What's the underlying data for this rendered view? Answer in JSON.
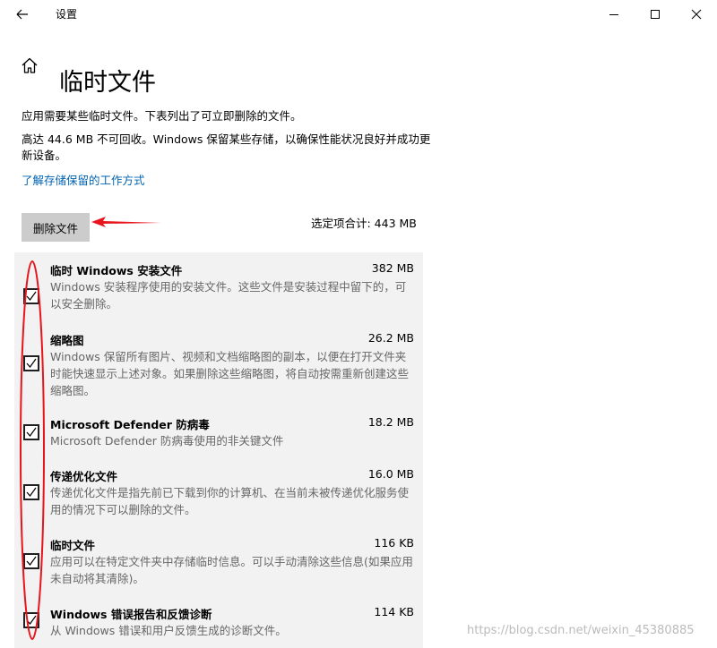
{
  "window": {
    "title": "设置",
    "back_icon": "back-arrow-icon",
    "minimize_icon": "minimize-icon",
    "maximize_icon": "maximize-icon",
    "close_icon": "close-icon"
  },
  "page": {
    "home_icon": "home-icon",
    "title": "临时文件",
    "description_1": "应用需要某些临时文件。下表列出了可立即删除的文件。",
    "description_2": "高达 44.6 MB 不可回收。Windows 保留某些存储，以确保性能状况良好并成功更新设备。",
    "learn_more_link": "了解存储保留的工作方式",
    "delete_button": "删除文件",
    "selected_total": "选定项合计: 443 MB"
  },
  "files": [
    {
      "name": "临时 Windows 安装文件",
      "size": "382 MB",
      "checked": true,
      "description": "Windows 安装程序使用的安装文件。这些文件是安装过程中留下的，可以安全删除。"
    },
    {
      "name": "缩略图",
      "size": "26.2 MB",
      "checked": true,
      "description": "Windows 保留所有图片、视频和文档缩略图的副本，以便在打开文件夹时能快速显示上述对象。如果删除这些缩略图，将自动按需重新创建这些缩略图。"
    },
    {
      "name": "Microsoft Defender 防病毒",
      "size": "18.2 MB",
      "checked": true,
      "description": "Microsoft Defender 防病毒使用的非关键文件"
    },
    {
      "name": "传递优化文件",
      "size": "16.0 MB",
      "checked": true,
      "description": "传递优化文件是指先前已下载到你的计算机、在当前未被传递优化服务使用的情况下可以删除的文件。"
    },
    {
      "name": "临时文件",
      "size": "116 KB",
      "checked": true,
      "description": "应用可以在特定文件夹中存储临时信息。可以手动清除这些信息(如果应用未自动将其清除)。"
    },
    {
      "name": "Windows 错误报告和反馈诊断",
      "size": "114 KB",
      "checked": true,
      "description": "从 Windows 错误和用户反馈生成的诊断文件。"
    }
  ],
  "annotation": {
    "color": "#e8141c"
  },
  "watermark": "https://blog.csdn.net/weixin_45380885",
  "colors": {
    "accent": "#0063b1",
    "button_bg": "#cccccc",
    "list_bg": "#f2f2f2",
    "secondary_text": "#666666"
  }
}
